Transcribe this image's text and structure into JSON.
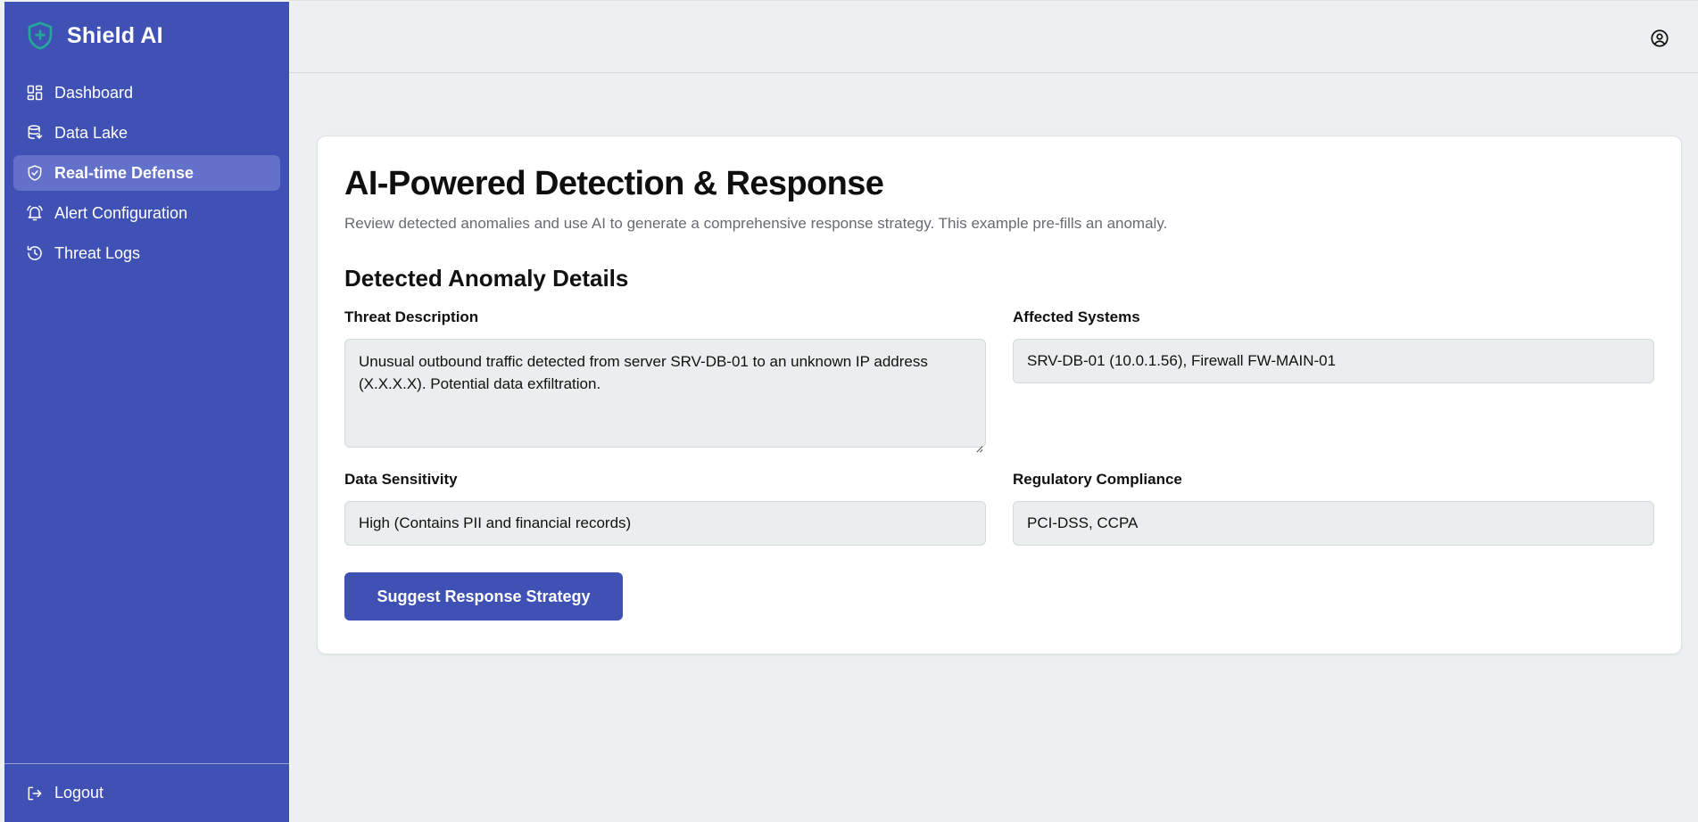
{
  "brand": {
    "name": "Shield AI",
    "icon": "shield-plus-icon"
  },
  "colors": {
    "sidebar": "#3f51b5",
    "active_item": "#6471cb",
    "primary_button": "#3f51b5",
    "logo": "#26a69a"
  },
  "sidebar": {
    "items": [
      {
        "label": "Dashboard",
        "icon": "dashboard-icon"
      },
      {
        "label": "Data Lake",
        "icon": "database-icon"
      },
      {
        "label": "Real-time Defense",
        "icon": "shield-check-icon",
        "active": true
      },
      {
        "label": "Alert Configuration",
        "icon": "bell-icon"
      },
      {
        "label": "Threat Logs",
        "icon": "history-icon"
      }
    ],
    "logout_label": "Logout"
  },
  "header": {
    "user_icon": "user-circle-icon"
  },
  "main": {
    "title": "AI-Powered Detection & Response",
    "subtitle": "Review detected anomalies and use AI to generate a comprehensive response strategy. This example pre-fills an anomaly.",
    "section_title": "Detected Anomaly Details",
    "fields": {
      "threat_description": {
        "label": "Threat Description",
        "value": "Unusual outbound traffic detected from server SRV-DB-01 to an unknown IP address (X.X.X.X). Potential data exfiltration."
      },
      "affected_systems": {
        "label": "Affected Systems",
        "value": "SRV-DB-01 (10.0.1.56), Firewall FW-MAIN-01"
      },
      "data_sensitivity": {
        "label": "Data Sensitivity",
        "value": "High (Contains PII and financial records)"
      },
      "regulatory_compliance": {
        "label": "Regulatory Compliance",
        "value": "PCI-DSS, CCPA"
      }
    },
    "submit_label": "Suggest Response Strategy"
  }
}
